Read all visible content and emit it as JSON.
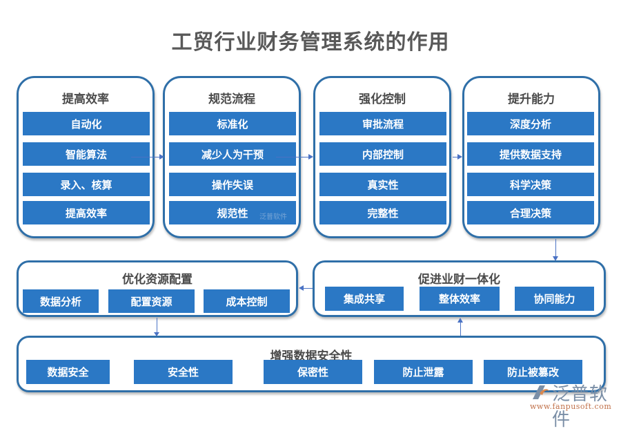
{
  "title": "工贸行业财务管理系统的作用",
  "colors": {
    "accent": "#2b78c5",
    "border": "#2f6fa8",
    "arrow": "#4a72c4",
    "title": "#595959"
  },
  "top_panels": [
    {
      "title": "提高效率",
      "items": [
        "自动化",
        "智能算法",
        "录入、核算",
        "提高效率"
      ]
    },
    {
      "title": "规范流程",
      "items": [
        "标准化",
        "减少人为干预",
        "操作失误",
        "规范性"
      ]
    },
    {
      "title": "强化控制",
      "items": [
        "审批流程",
        "内部控制",
        "真实性",
        "完整性"
      ]
    },
    {
      "title": "提升能力",
      "items": [
        "深度分析",
        "提供数据支持",
        "科学决策",
        "合理决策"
      ]
    }
  ],
  "middle_panels": [
    {
      "title": "优化资源配置",
      "items": [
        "数据分析",
        "配置资源",
        "成本控制"
      ]
    },
    {
      "title": "促进业财一体化",
      "items": [
        "集成共享",
        "整体效率",
        "协同能力"
      ]
    }
  ],
  "bottom_panel": {
    "title": "增强数据安全性",
    "items": [
      "数据安全",
      "安全性",
      "保密性",
      "防止泄露",
      "防止被篡改"
    ]
  },
  "watermark": "泛普软件",
  "logo": {
    "name": "泛普软件",
    "url": "www.fanpusoft.com",
    "icon": "fanpu-logo-icon"
  }
}
